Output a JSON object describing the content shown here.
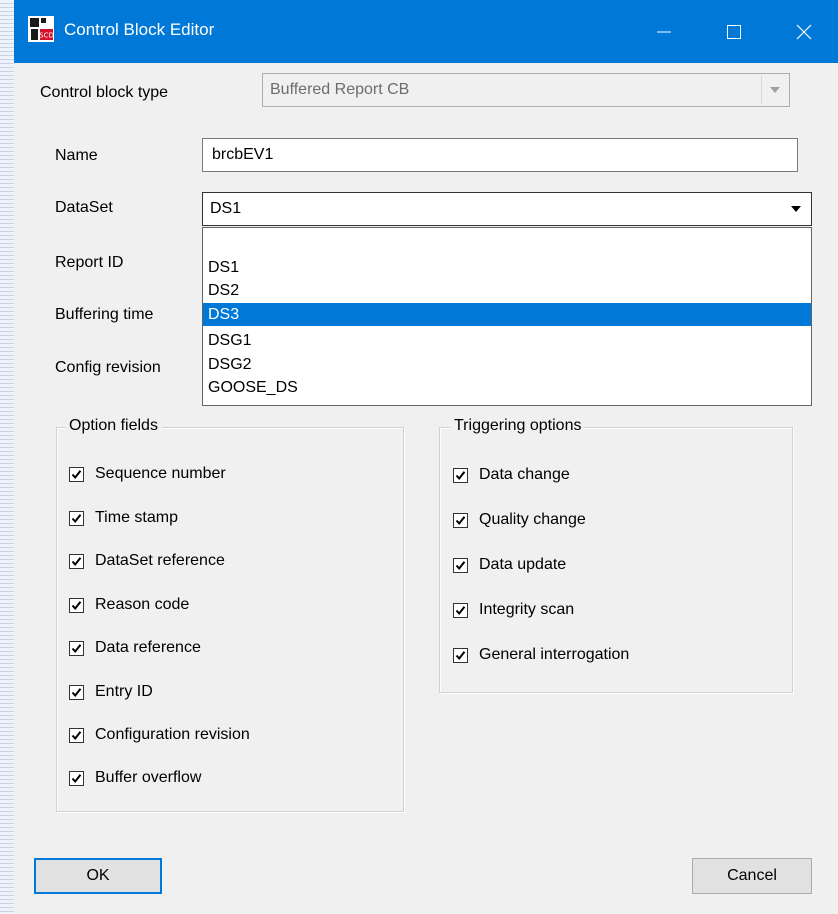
{
  "window": {
    "title": "Control Block Editor",
    "icon": "scd-app-icon",
    "accent_color": "#0078d7"
  },
  "form": {
    "control_block_type": {
      "label": "Control block type",
      "value": "Buffered Report CB"
    },
    "name": {
      "label": "Name",
      "value": "brcbEV1"
    },
    "dataset": {
      "label": "DataSet",
      "value": "DS1",
      "options": [
        "",
        "DS1",
        "DS2",
        "DS3",
        "DSG1",
        "DSG2",
        "GOOSE_DS"
      ],
      "highlighted": "DS3"
    },
    "report_id": {
      "label": "Report ID"
    },
    "buffering_time": {
      "label": "Buffering time"
    },
    "config_revision": {
      "label": "Config revision"
    }
  },
  "option_fields": {
    "title": "Option fields",
    "items": [
      {
        "label": "Sequence number",
        "checked": true
      },
      {
        "label": "Time stamp",
        "checked": true
      },
      {
        "label": "DataSet reference",
        "checked": true
      },
      {
        "label": "Reason code",
        "checked": true
      },
      {
        "label": "Data reference",
        "checked": true
      },
      {
        "label": "Entry ID",
        "checked": true
      },
      {
        "label": "Configuration revision",
        "checked": true
      },
      {
        "label": "Buffer overflow",
        "checked": true
      }
    ]
  },
  "triggering_options": {
    "title": "Triggering options",
    "items": [
      {
        "label": "Data change",
        "checked": true
      },
      {
        "label": "Quality change",
        "checked": true
      },
      {
        "label": "Data update",
        "checked": true
      },
      {
        "label": "Integrity scan",
        "checked": true
      },
      {
        "label": "General interrogation",
        "checked": true
      }
    ]
  },
  "buttons": {
    "ok": "OK",
    "cancel": "Cancel"
  }
}
